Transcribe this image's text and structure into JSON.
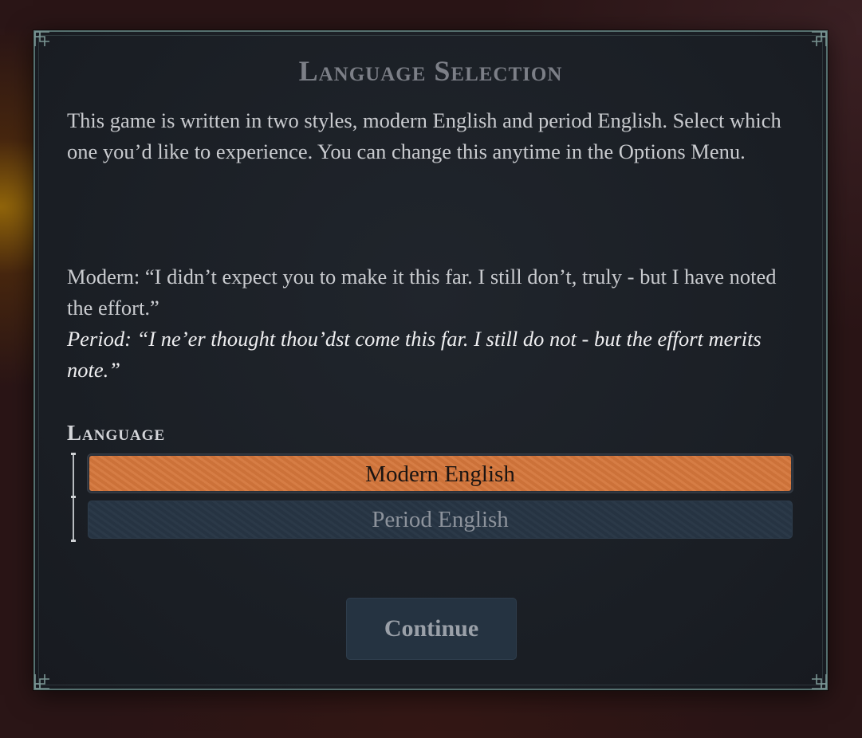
{
  "dialog": {
    "title": "Language Selection",
    "intro": "This game is written in two styles, modern English and period English.  Select which one you’d like to experience. You can change this anytime in the Options Menu.",
    "sample_modern": "Modern: “I didn’t expect you to make it this far. I still don’t, truly - but I have noted the effort.”",
    "sample_period": "Period: “I ne’er thought thou’dst come this far. I still do not - but the effort merits note.”",
    "language_label": "Language",
    "options": [
      {
        "label": "Modern English",
        "selected": true
      },
      {
        "label": "Period English",
        "selected": false
      }
    ],
    "continue_label": "Continue"
  },
  "colors": {
    "selected_option": "#d4763b",
    "unselected_option": "#273544",
    "panel_bg": "#1a1e24",
    "panel_border": "#55706f"
  }
}
